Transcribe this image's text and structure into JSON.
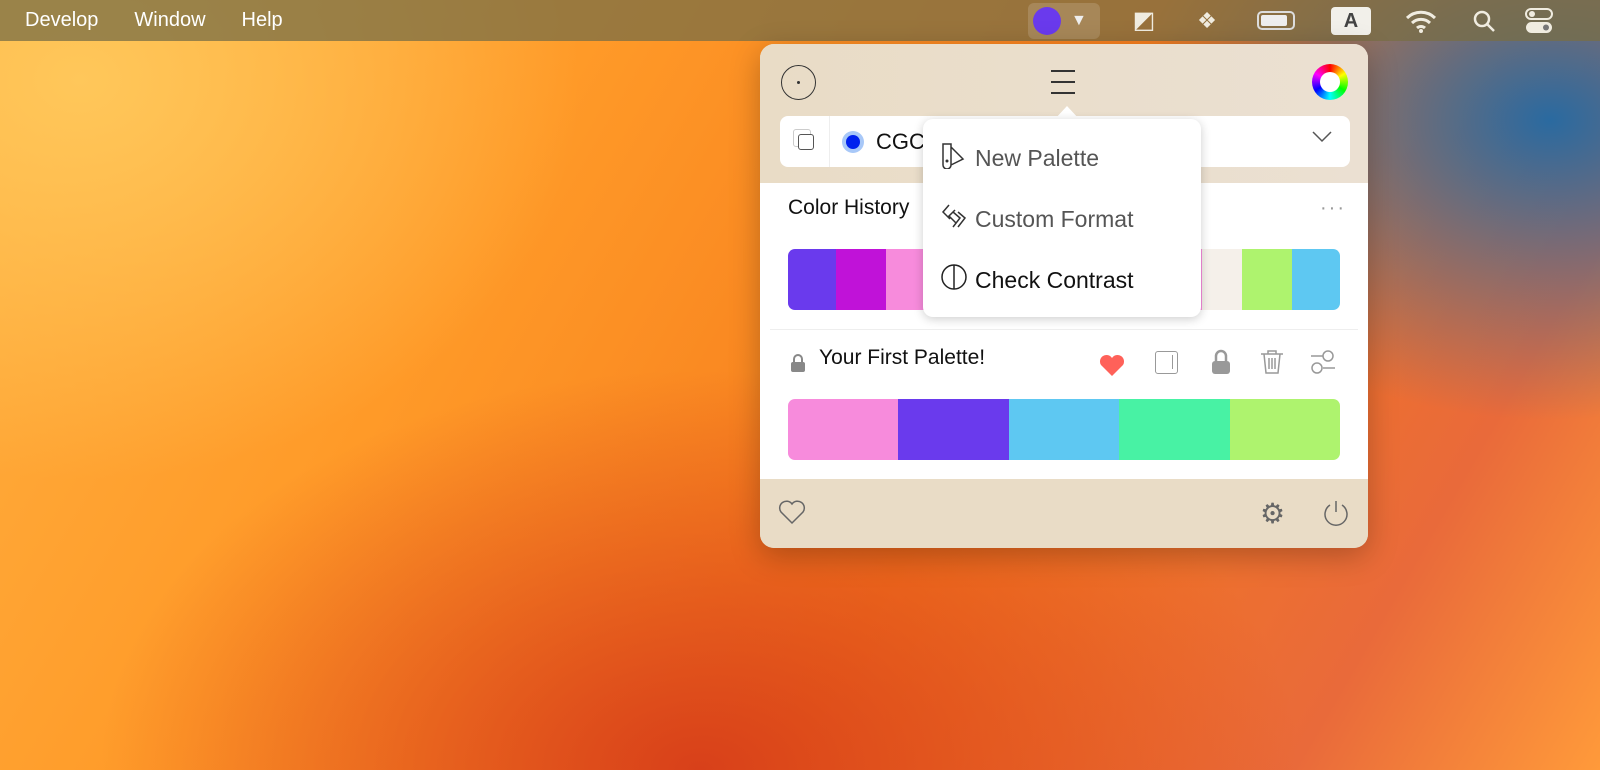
{
  "menubar": {
    "items": [
      "Develop",
      "Window",
      "Help"
    ],
    "input_badge": "A"
  },
  "panel": {
    "selector": {
      "format": "CGC"
    },
    "history": {
      "title": "Color History",
      "more": "···",
      "colors": [
        "#6a3aed",
        "#c012d8",
        "#f78bdc",
        "#f5f0ea",
        "#aef36e",
        "#5ec8f2"
      ]
    },
    "palette": {
      "title": "Your First Palette!",
      "colors": [
        "#f78bdc",
        "#6a3aed",
        "#5ec8f2",
        "#48f2a4",
        "#aef36e"
      ],
      "favorite_color": "#ff6159"
    }
  },
  "dropdown": {
    "items": [
      {
        "label": "New Palette",
        "icon": "palette-icon"
      },
      {
        "label": "Custom Format",
        "icon": "format-icon"
      },
      {
        "label": "Check Contrast",
        "icon": "contrast-icon"
      }
    ]
  }
}
